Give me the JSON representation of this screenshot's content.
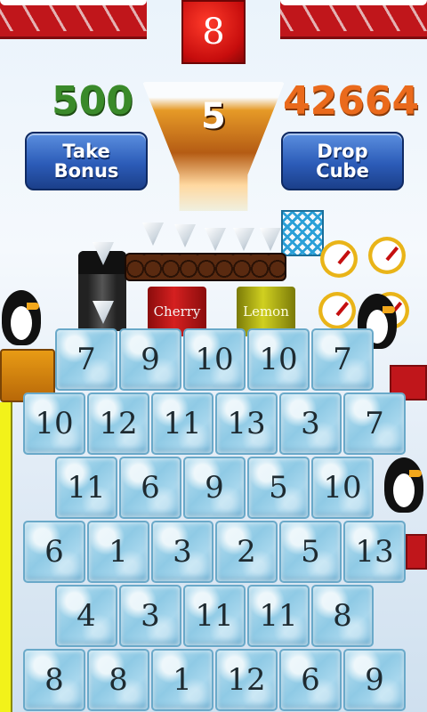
{
  "header": {
    "level": "8"
  },
  "scores": {
    "bonus": "500",
    "total": "42664"
  },
  "glass": {
    "count": "5"
  },
  "buttons": {
    "take_bonus": "Take\nBonus",
    "drop_cube": "Drop\nCube"
  },
  "cans": {
    "cherry": "Cherry",
    "lemon": "Lemon"
  },
  "colors": {
    "bonus_green": "#3a8a2a",
    "score_orange": "#ea6a1c",
    "level_red": "#c70d0d",
    "button_blue": "#2c5cb8"
  },
  "board": {
    "rows": [
      [
        "7",
        "9",
        "10",
        "10",
        "7"
      ],
      [
        "10",
        "12",
        "11",
        "13",
        "3",
        "7"
      ],
      [
        "11",
        "6",
        "9",
        "5",
        "10"
      ],
      [
        "6",
        "1",
        "3",
        "2",
        "5",
        "13"
      ],
      [
        "4",
        "3",
        "11",
        "11",
        "8"
      ],
      [
        "8",
        "8",
        "1",
        "12",
        "6",
        "9"
      ]
    ]
  }
}
